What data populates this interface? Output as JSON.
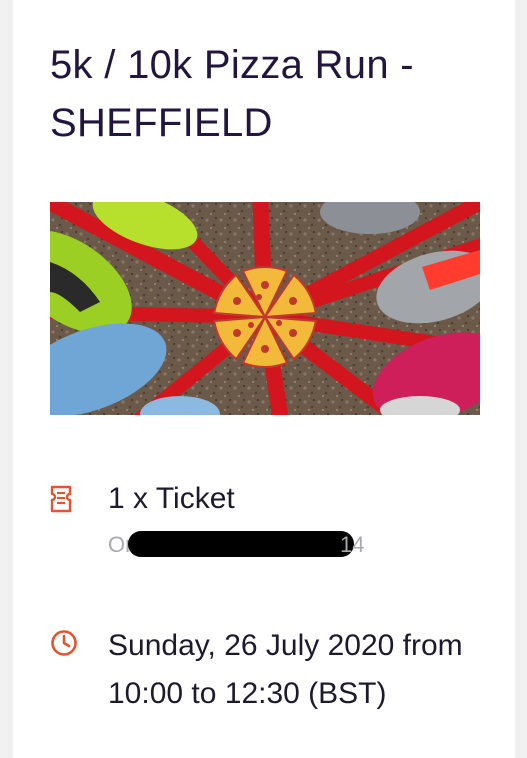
{
  "event": {
    "title": "5k / 10k Pizza Run - SHEFFIELD"
  },
  "ticket": {
    "summary": "1 x Ticket",
    "order_label": "Order",
    "order_suffix": "14"
  },
  "schedule": {
    "date_time": "Sunday, 26 July 2020 from 10:00 to 12:30 (BST)"
  },
  "icons": {
    "ticket": "ticket-icon",
    "clock": "clock-icon"
  },
  "colors": {
    "title": "#22163f",
    "icon_accent": "#e5532f",
    "body_text": "#1e1a2e",
    "muted_text": "#a9a9ae"
  }
}
